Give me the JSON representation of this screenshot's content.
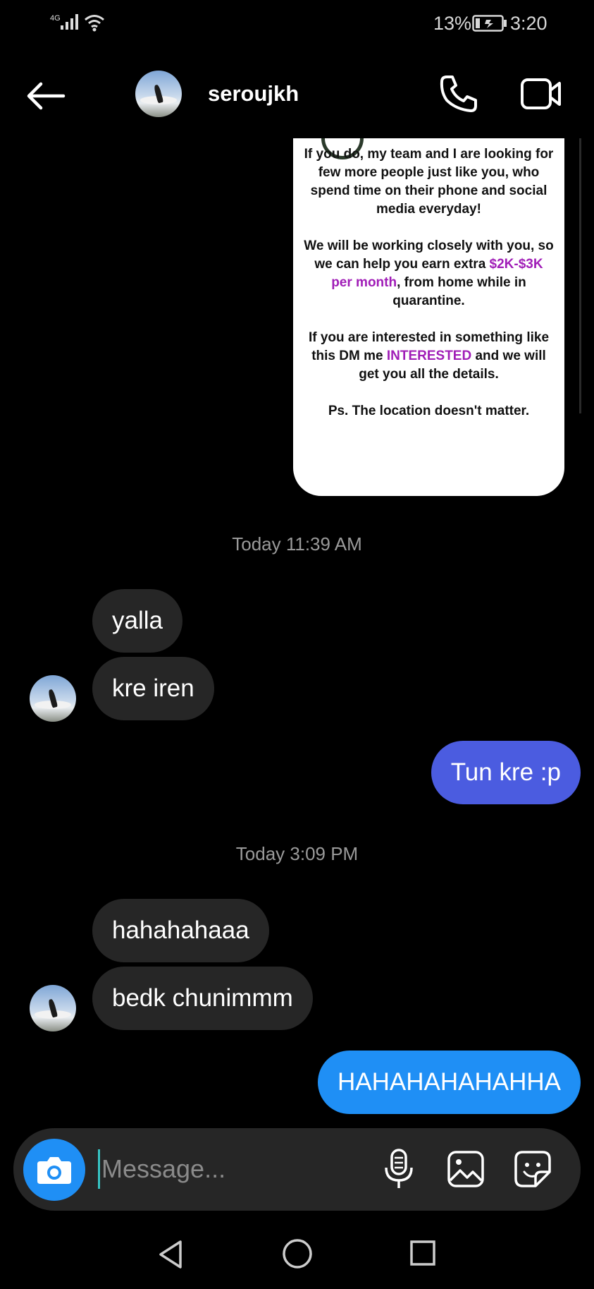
{
  "status_bar": {
    "network": "4G",
    "battery_percent": "13%",
    "time": "3:20"
  },
  "header": {
    "username": "seroujkh",
    "back_icon": "arrow-left-icon",
    "call_icon": "phone-icon",
    "video_icon": "video-camera-icon"
  },
  "shared_post": {
    "paragraphs": [
      [
        "If you do, my team and I are looking for few more people just like you, who spend time on their phone and social media everyday!"
      ],
      [
        "We will be working closely with you, so we can help you earn extra ",
        "$2K-$3K per month",
        ", from home while in quarantine."
      ],
      [
        "If you are interested in something like this DM me ",
        "INTERESTED",
        " and we will get you all the details."
      ],
      [
        "Ps. The location doesn't matter."
      ]
    ],
    "highlight_color": "#a01db7"
  },
  "conversation": {
    "timestamp_1": "Today 11:39 AM",
    "msg_1": "yalla",
    "msg_2": "kre iren",
    "msg_3": "Tun kre :p",
    "timestamp_2": "Today 3:09 PM",
    "msg_4": "hahahahaaa",
    "msg_5": "bedk chunimmm",
    "msg_6": "HAHAHAHAHAHHA"
  },
  "composer": {
    "placeholder": "Message...",
    "camera_icon": "camera-icon",
    "mic_icon": "microphone-icon",
    "gallery_icon": "image-icon",
    "sticker_icon": "sticker-icon"
  },
  "colors": {
    "background": "#000000",
    "incoming_bubble": "#262626",
    "outgoing_bubble_purple": "#4b5ce0",
    "outgoing_bubble_blue": "#1f8ff5",
    "accent": "#1f8ff5"
  }
}
